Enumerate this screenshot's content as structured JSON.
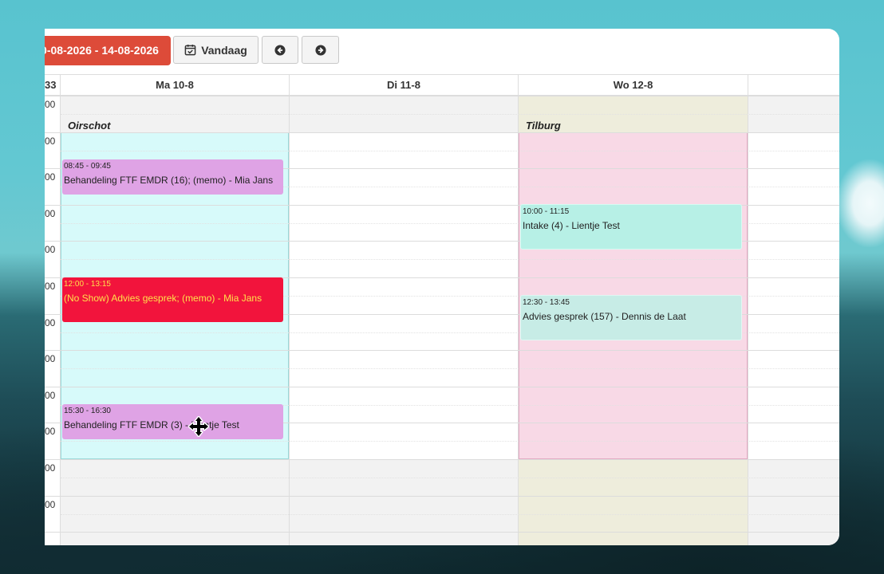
{
  "toolbar": {
    "range_label": "0-08-2026 - 14-08-2026",
    "today_label": "Vandaag",
    "prev_icon": "arrow-left-circle-icon",
    "next_icon": "arrow-right-circle-icon",
    "calendar_icon": "calendar-check-icon"
  },
  "calendar": {
    "week_number": "33",
    "days": [
      {
        "label": "Ma 10-8"
      },
      {
        "label": "Di 11-8"
      },
      {
        "label": "Wo 12-8"
      }
    ],
    "time_labels": [
      "00",
      "00",
      "00",
      "00",
      "00",
      "00",
      "00",
      "00",
      "00",
      "00",
      "00",
      "00"
    ],
    "locations": {
      "monday": "Oirschot",
      "wednesday": "Tilburg"
    },
    "events": [
      {
        "day": "Ma 10-8",
        "time": "08:45 - 09:45",
        "desc": "Behandeling FTF EMDR (16); (memo) - Mia Jans",
        "color": "#dfa3e5"
      },
      {
        "day": "Ma 10-8",
        "time": "12:00 - 13:15",
        "desc": "(No Show) Advies gesprek; (memo) - Mia Jans",
        "color": "#f2143c",
        "text_color": "#ffe14a"
      },
      {
        "day": "Ma 10-8",
        "time": "15:30 - 16:30",
        "desc": "Behandeling FTF EMDR (3) - Lientje Test",
        "color": "#dfa3e5"
      },
      {
        "day": "Wo 12-8",
        "time": "10:00 - 11:15",
        "desc": "Intake (4) - Lientje Test",
        "color": "#b7f0e6"
      },
      {
        "day": "Wo 12-8",
        "time": "12:30 - 13:45",
        "desc": "Advies gesprek (157) - Dennis de Laat",
        "color": "#c7ece6"
      }
    ]
  },
  "colors": {
    "accent_red": "#dd4b39",
    "monday_bg": "#d7fafa",
    "wednesday_bg": "#f8d9e6",
    "closed_bg": "#f2f2f2",
    "wed_closed_bg": "#eeeddc"
  },
  "cursor_icon": "move-cursor-icon"
}
